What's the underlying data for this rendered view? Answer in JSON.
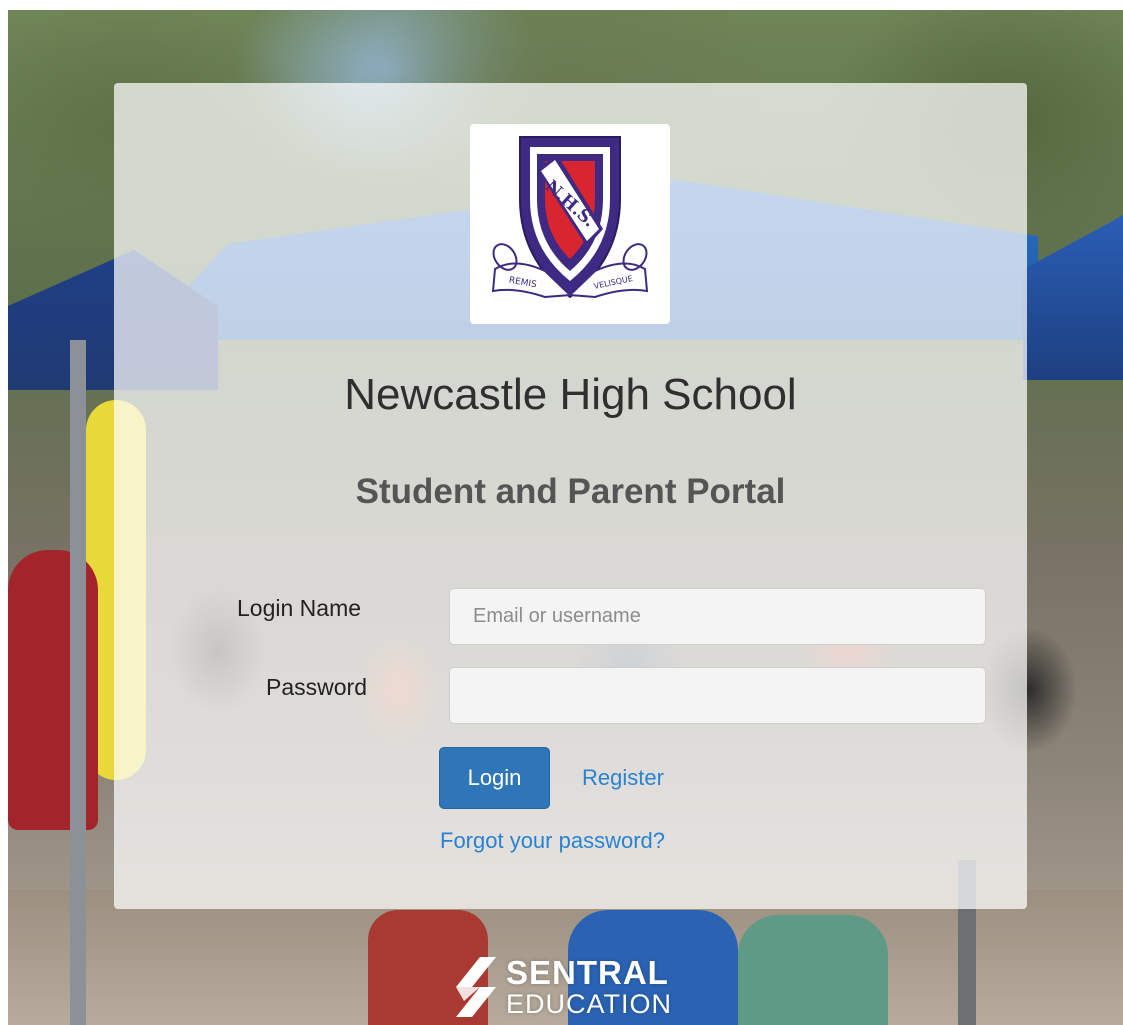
{
  "school": {
    "name": "Newcastle High School",
    "portal_title": "Student and Parent Portal",
    "crest": {
      "initials": "N.H.S.",
      "motto_left": "REMIS",
      "motto_right": "VELISQUE",
      "colors": {
        "shield": "#3e2a83",
        "field": "#d8252f",
        "scroll": "#ffffff"
      }
    }
  },
  "form": {
    "login_label": "Login Name",
    "login_placeholder": "Email or username",
    "login_value": "",
    "password_label": "Password",
    "password_value": "",
    "login_button": "Login",
    "register_link": "Register",
    "forgot_link": "Forgot your password?"
  },
  "footer": {
    "brand_word": "SENTRAL",
    "brand_sub": "EDUCATION"
  },
  "colors": {
    "primary_button": "#2e76b8",
    "link": "#2a82d3",
    "card_background": "rgba(255,255,255,0.72)"
  }
}
